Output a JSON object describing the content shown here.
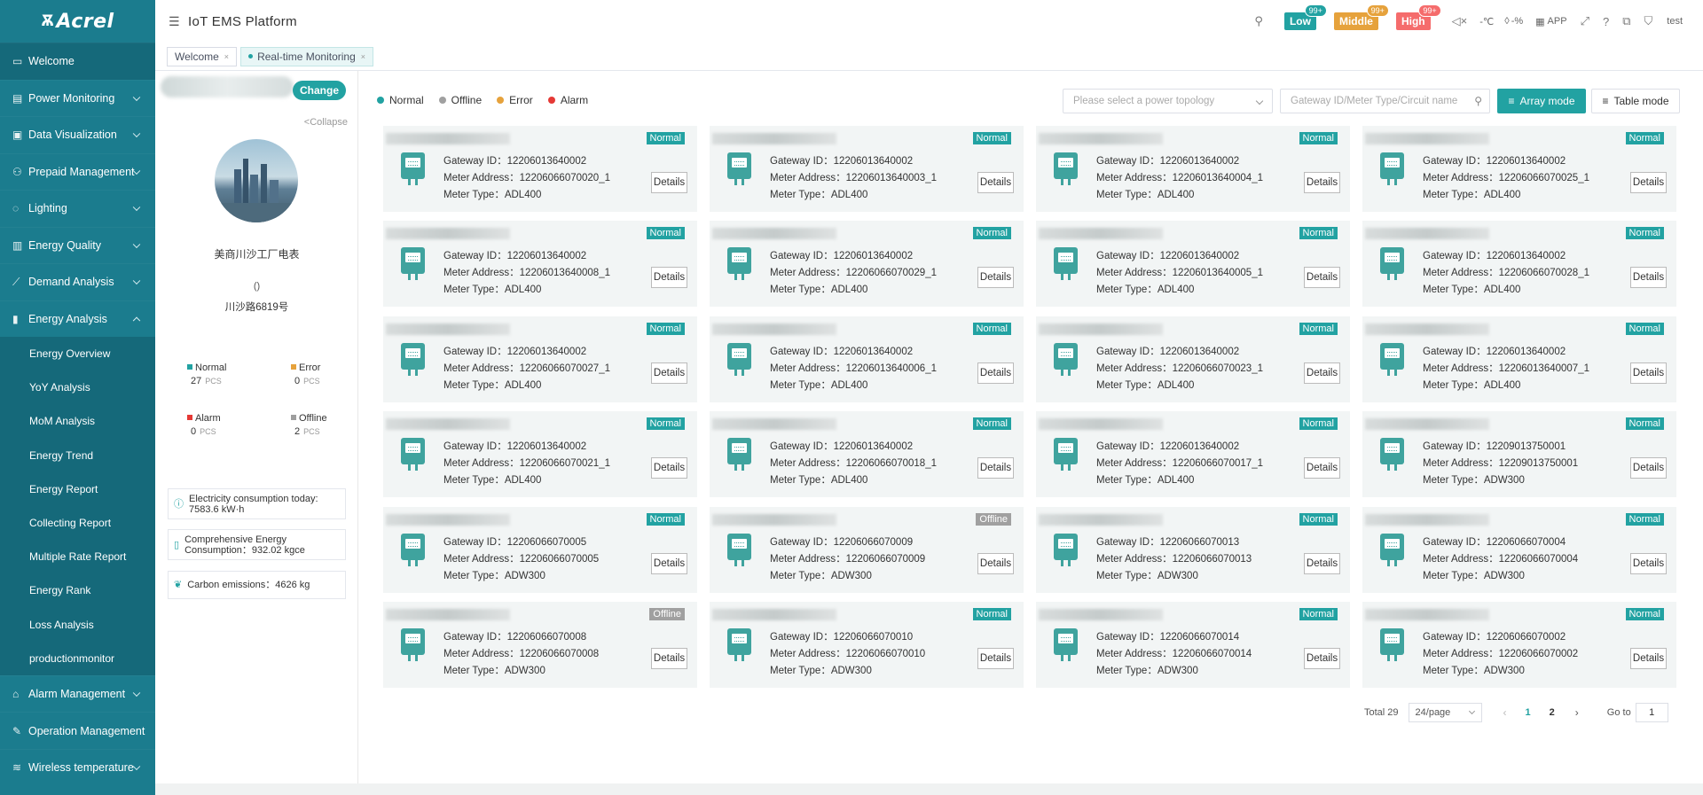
{
  "brand": {
    "logo_text": "Acrel"
  },
  "header": {
    "title": "IoT EMS Platform",
    "alarms": [
      {
        "label": "Low",
        "count": "99+",
        "color": "#22a2a2"
      },
      {
        "label": "Middle",
        "count": "99+",
        "color": "#e6a23c"
      },
      {
        "label": "High",
        "count": "99+",
        "color": "#f56c6c"
      }
    ],
    "temp": "-℃",
    "humidity": "-%",
    "app_label": "APP",
    "user": "test"
  },
  "tabs": [
    {
      "label": "Welcome",
      "close": "×"
    },
    {
      "label": "Real-time Monitoring",
      "close": "×"
    }
  ],
  "sidebar": {
    "items": [
      {
        "label": "Welcome"
      },
      {
        "label": "Power Monitoring"
      },
      {
        "label": "Data Visualization"
      },
      {
        "label": "Prepaid Management"
      },
      {
        "label": "Lighting"
      },
      {
        "label": "Energy Quality"
      },
      {
        "label": "Demand Analysis"
      },
      {
        "label": "Energy Analysis"
      }
    ],
    "sub_items": [
      {
        "label": "Energy Overview"
      },
      {
        "label": "YoY Analysis"
      },
      {
        "label": "MoM Analysis"
      },
      {
        "label": "Energy Trend"
      },
      {
        "label": "Energy Report"
      },
      {
        "label": "Collecting Report"
      },
      {
        "label": "Multiple Rate Report"
      },
      {
        "label": "Energy Rank"
      },
      {
        "label": "Loss Analysis"
      },
      {
        "label": "productionmonitor"
      }
    ],
    "bottom_items": [
      {
        "label": "Alarm Management"
      },
      {
        "label": "Operation Management"
      },
      {
        "label": "Wireless temperature"
      }
    ]
  },
  "left_panel": {
    "change_label": "Change",
    "collapse_label": "<Collapse",
    "site_name": "美商川沙工厂电表",
    "site_paren": "()",
    "site_address": "川沙路6819号",
    "stats": [
      {
        "label": "Normal",
        "value": "27",
        "unit": "PCS",
        "color": "#22a2a2"
      },
      {
        "label": "Error",
        "value": "0",
        "unit": "PCS",
        "color": "#e6a23c"
      },
      {
        "label": "Alarm",
        "value": "0",
        "unit": "PCS",
        "color": "#e53935"
      },
      {
        "label": "Offline",
        "value": "2",
        "unit": "PCS",
        "color": "#9e9e9e"
      }
    ],
    "electricity_today": "Electricity consumption today: 7583.6 kW·h",
    "comprehensive": "Comprehensive Energy Consumption：932.02 kgce",
    "carbon": "Carbon emissions：4626 kg"
  },
  "main": {
    "legend": [
      {
        "label": "Normal",
        "color": "#22a2a2"
      },
      {
        "label": "Offline",
        "color": "#a0a0a0"
      },
      {
        "label": "Error",
        "color": "#e6a23c"
      },
      {
        "label": "Alarm",
        "color": "#e53935"
      }
    ],
    "topology_placeholder": "Please select a power topology",
    "search_placeholder": "Gateway ID/Meter Type/Circuit name",
    "array_mode_label": "Array mode",
    "table_mode_label": "Table mode",
    "gateway_prefix": "Gateway ID：",
    "address_prefix": "Meter Address：",
    "type_prefix": "Meter Type：",
    "details_label": "Details",
    "status_colors": {
      "Normal": "#22a2a2",
      "Offline": "#a0a0a0"
    },
    "cards": [
      {
        "status": "Normal",
        "gateway": "12206013640002",
        "address": "12206066070020_1",
        "type": "ADL400"
      },
      {
        "status": "Normal",
        "gateway": "12206013640002",
        "address": "12206013640003_1",
        "type": "ADL400"
      },
      {
        "status": "Normal",
        "gateway": "12206013640002",
        "address": "12206013640004_1",
        "type": "ADL400"
      },
      {
        "status": "Normal",
        "gateway": "12206013640002",
        "address": "12206066070025_1",
        "type": "ADL400"
      },
      {
        "status": "Normal",
        "gateway": "12206013640002",
        "address": "12206013640008_1",
        "type": "ADL400"
      },
      {
        "status": "Normal",
        "gateway": "12206013640002",
        "address": "12206066070029_1",
        "type": "ADL400"
      },
      {
        "status": "Normal",
        "gateway": "12206013640002",
        "address": "12206013640005_1",
        "type": "ADL400"
      },
      {
        "status": "Normal",
        "gateway": "12206013640002",
        "address": "12206066070028_1",
        "type": "ADL400"
      },
      {
        "status": "Normal",
        "gateway": "12206013640002",
        "address": "12206066070027_1",
        "type": "ADL400"
      },
      {
        "status": "Normal",
        "gateway": "12206013640002",
        "address": "12206013640006_1",
        "type": "ADL400"
      },
      {
        "status": "Normal",
        "gateway": "12206013640002",
        "address": "12206066070023_1",
        "type": "ADL400"
      },
      {
        "status": "Normal",
        "gateway": "12206013640002",
        "address": "12206013640007_1",
        "type": "ADL400"
      },
      {
        "status": "Normal",
        "gateway": "12206013640002",
        "address": "12206066070021_1",
        "type": "ADL400"
      },
      {
        "status": "Normal",
        "gateway": "12206013640002",
        "address": "12206066070018_1",
        "type": "ADL400"
      },
      {
        "status": "Normal",
        "gateway": "12206013640002",
        "address": "12206066070017_1",
        "type": "ADL400"
      },
      {
        "status": "Normal",
        "gateway": "12209013750001",
        "address": "12209013750001",
        "type": "ADW300"
      },
      {
        "status": "Normal",
        "gateway": "12206066070005",
        "address": "12206066070005",
        "type": "ADW300"
      },
      {
        "status": "Offline",
        "gateway": "12206066070009",
        "address": "12206066070009",
        "type": "ADW300"
      },
      {
        "status": "Normal",
        "gateway": "12206066070013",
        "address": "12206066070013",
        "type": "ADW300"
      },
      {
        "status": "Normal",
        "gateway": "12206066070004",
        "address": "12206066070004",
        "type": "ADW300"
      },
      {
        "status": "Offline",
        "gateway": "12206066070008",
        "address": "12206066070008",
        "type": "ADW300"
      },
      {
        "status": "Normal",
        "gateway": "12206066070010",
        "address": "12206066070010",
        "type": "ADW300"
      },
      {
        "status": "Normal",
        "gateway": "12206066070014",
        "address": "12206066070014",
        "type": "ADW300"
      },
      {
        "status": "Normal",
        "gateway": "12206066070002",
        "address": "12206066070002",
        "type": "ADW300"
      }
    ],
    "pagination": {
      "total": "Total 29",
      "page_size": "24/page",
      "pages": [
        "1",
        "2"
      ],
      "current": "1",
      "goto_label": "Go to",
      "goto_value": "1",
      "prev": "‹",
      "next": "›"
    }
  }
}
